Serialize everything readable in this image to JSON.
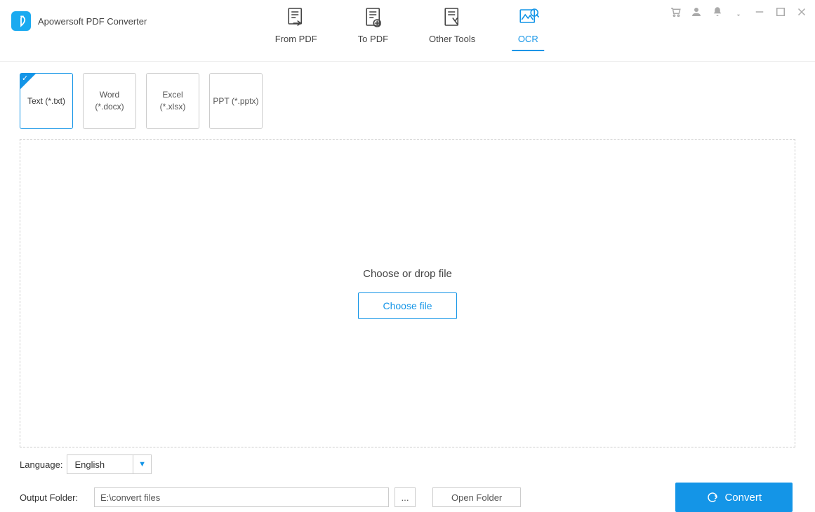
{
  "app": {
    "title": "Apowersoft PDF Converter"
  },
  "tabs": {
    "from_pdf": "From PDF",
    "to_pdf": "To PDF",
    "other_tools": "Other Tools",
    "ocr": "OCR"
  },
  "formats": {
    "txt": "Text (*.txt)",
    "docx_line1": "Word",
    "docx_line2": "(*.docx)",
    "xlsx": "Excel (*.xlsx)",
    "pptx": "PPT (*.pptx)"
  },
  "dropzone": {
    "hint": "Choose or drop file",
    "choose": "Choose file"
  },
  "language": {
    "label": "Language:",
    "value": "English"
  },
  "output": {
    "label": "Output Folder:",
    "path": "E:\\convert files",
    "open": "Open Folder"
  },
  "actions": {
    "convert": "Convert"
  }
}
